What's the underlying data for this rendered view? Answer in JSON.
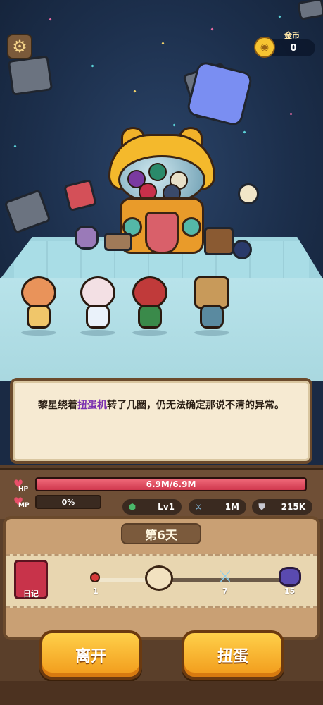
{
  "hud": {
    "gold_label": "金币",
    "gold_value": "0"
  },
  "dialog": {
    "text_before": "黎星绕着",
    "highlight": "扭蛋机",
    "text_after": "转了几圈，仍无法确定那说不清的异常。"
  },
  "stats": {
    "hp_label": "HP",
    "hp_value": "6.9M/6.9M",
    "hp_fraction": 1.0,
    "mp_label": "MP",
    "mp_value": "0%",
    "level": "Lv1",
    "attack": "1M",
    "defense": "215K"
  },
  "map": {
    "day_title": "第6天",
    "diary_label": "日记",
    "nodes": [
      {
        "name": "start-node",
        "num": "1"
      },
      {
        "name": "sword-node",
        "num": "7"
      },
      {
        "name": "boss-node",
        "num": "15"
      }
    ]
  },
  "buttons": {
    "leave": "离开",
    "gacha": "扭蛋"
  },
  "colors": {
    "accent_gold": "#f19a1a",
    "hp_red": "#d0384e",
    "highlight_purple": "#7a2fb0"
  }
}
